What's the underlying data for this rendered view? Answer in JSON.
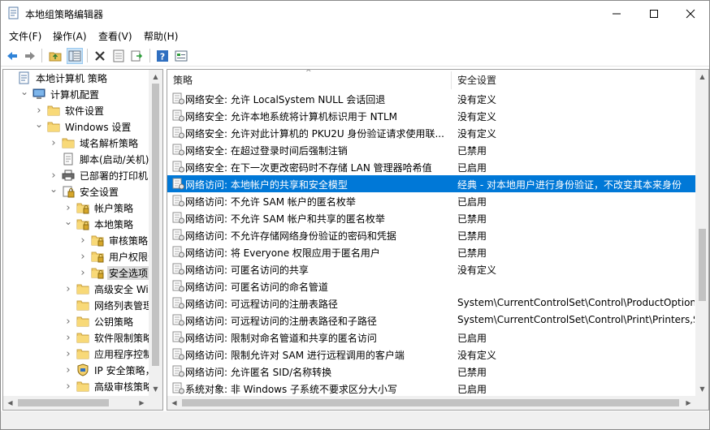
{
  "window": {
    "title": "本地组策略编辑器"
  },
  "menu": [
    "文件(F)",
    "操作(A)",
    "查看(V)",
    "帮助(H)"
  ],
  "toolbar": {
    "buttons": [
      "back-icon",
      "forward-icon",
      "up-folder-icon",
      "show-tree-icon",
      "delete-icon",
      "properties-icon",
      "export-icon",
      "help-icon",
      "filter-icon"
    ]
  },
  "tree": [
    {
      "label": "本地计算机 策略",
      "level": 0,
      "expander": "",
      "icon": "computer-policy-icon"
    },
    {
      "label": "计算机配置",
      "level": 1,
      "expander": "open",
      "icon": "computer-icon"
    },
    {
      "label": "软件设置",
      "level": 2,
      "expander": "closed",
      "icon": "folder-icon"
    },
    {
      "label": "Windows 设置",
      "level": 2,
      "expander": "open",
      "icon": "folder-icon"
    },
    {
      "label": "域名解析策略",
      "level": 3,
      "expander": "closed",
      "icon": "folder-icon"
    },
    {
      "label": "脚本(启动/关机)",
      "level": 3,
      "expander": "",
      "icon": "script-icon"
    },
    {
      "label": "已部署的打印机",
      "level": 3,
      "expander": "closed",
      "icon": "printer-icon"
    },
    {
      "label": "安全设置",
      "level": 3,
      "expander": "open",
      "icon": "security-icon"
    },
    {
      "label": "帐户策略",
      "level": 4,
      "expander": "closed",
      "icon": "folder-lock-icon"
    },
    {
      "label": "本地策略",
      "level": 4,
      "expander": "open",
      "icon": "folder-lock-icon"
    },
    {
      "label": "审核策略",
      "level": 5,
      "expander": "closed",
      "icon": "folder-lock-icon"
    },
    {
      "label": "用户权限分",
      "level": 5,
      "expander": "closed",
      "icon": "folder-lock-icon"
    },
    {
      "label": "安全选项",
      "level": 5,
      "expander": "closed",
      "icon": "folder-lock-icon",
      "selected": true
    },
    {
      "label": "高级安全 Wind",
      "level": 4,
      "expander": "closed",
      "icon": "folder-icon"
    },
    {
      "label": "网络列表管理器",
      "level": 4,
      "expander": "",
      "icon": "folder-icon"
    },
    {
      "label": "公钥策略",
      "level": 4,
      "expander": "closed",
      "icon": "folder-icon"
    },
    {
      "label": "软件限制策略",
      "level": 4,
      "expander": "closed",
      "icon": "folder-icon"
    },
    {
      "label": "应用程序控制",
      "level": 4,
      "expander": "closed",
      "icon": "folder-icon"
    },
    {
      "label": "IP 安全策略，在",
      "level": 4,
      "expander": "closed",
      "icon": "ip-security-icon"
    },
    {
      "label": "高级审核策略配",
      "level": 4,
      "expander": "closed",
      "icon": "folder-icon"
    }
  ],
  "list": {
    "columns": [
      "策略",
      "安全设置"
    ],
    "rows": [
      {
        "policy": "网络安全: 允许 LocalSystem NULL 会话回退",
        "setting": "没有定义"
      },
      {
        "policy": "网络安全: 允许本地系统将计算机标识用于 NTLM",
        "setting": "没有定义"
      },
      {
        "policy": "网络安全: 允许对此计算机的 PKU2U 身份验证请求使用联...",
        "setting": "没有定义"
      },
      {
        "policy": "网络安全: 在超过登录时间后强制注销",
        "setting": "已禁用"
      },
      {
        "policy": "网络安全: 在下一次更改密码时不存储 LAN 管理器哈希值",
        "setting": "已启用"
      },
      {
        "policy": "网络访问: 本地帐户的共享和安全模型",
        "setting": "经典 - 对本地用户进行身份验证，不改变其本来身份",
        "selected": true
      },
      {
        "policy": "网络访问: 不允许 SAM 帐户的匿名枚举",
        "setting": "已启用"
      },
      {
        "policy": "网络访问: 不允许 SAM 帐户和共享的匿名枚举",
        "setting": "已禁用"
      },
      {
        "policy": "网络访问: 不允许存储网络身份验证的密码和凭据",
        "setting": "已禁用"
      },
      {
        "policy": "网络访问: 将 Everyone 权限应用于匿名用户",
        "setting": "已禁用"
      },
      {
        "policy": "网络访问: 可匿名访问的共享",
        "setting": "没有定义"
      },
      {
        "policy": "网络访问: 可匿名访问的命名管道",
        "setting": ""
      },
      {
        "policy": "网络访问: 可远程访问的注册表路径",
        "setting": "System\\CurrentControlSet\\Control\\ProductOption..."
      },
      {
        "policy": "网络访问: 可远程访问的注册表路径和子路径",
        "setting": "System\\CurrentControlSet\\Control\\Print\\Printers,S..."
      },
      {
        "policy": "网络访问: 限制对命名管道和共享的匿名访问",
        "setting": "已启用"
      },
      {
        "policy": "网络访问: 限制允许对 SAM 进行远程调用的客户端",
        "setting": "没有定义"
      },
      {
        "policy": "网络访问: 允许匿名 SID/名称转换",
        "setting": "已禁用"
      },
      {
        "policy": "系统对象: 非 Windows 子系统不要求区分大小写",
        "setting": "已启用"
      }
    ]
  }
}
